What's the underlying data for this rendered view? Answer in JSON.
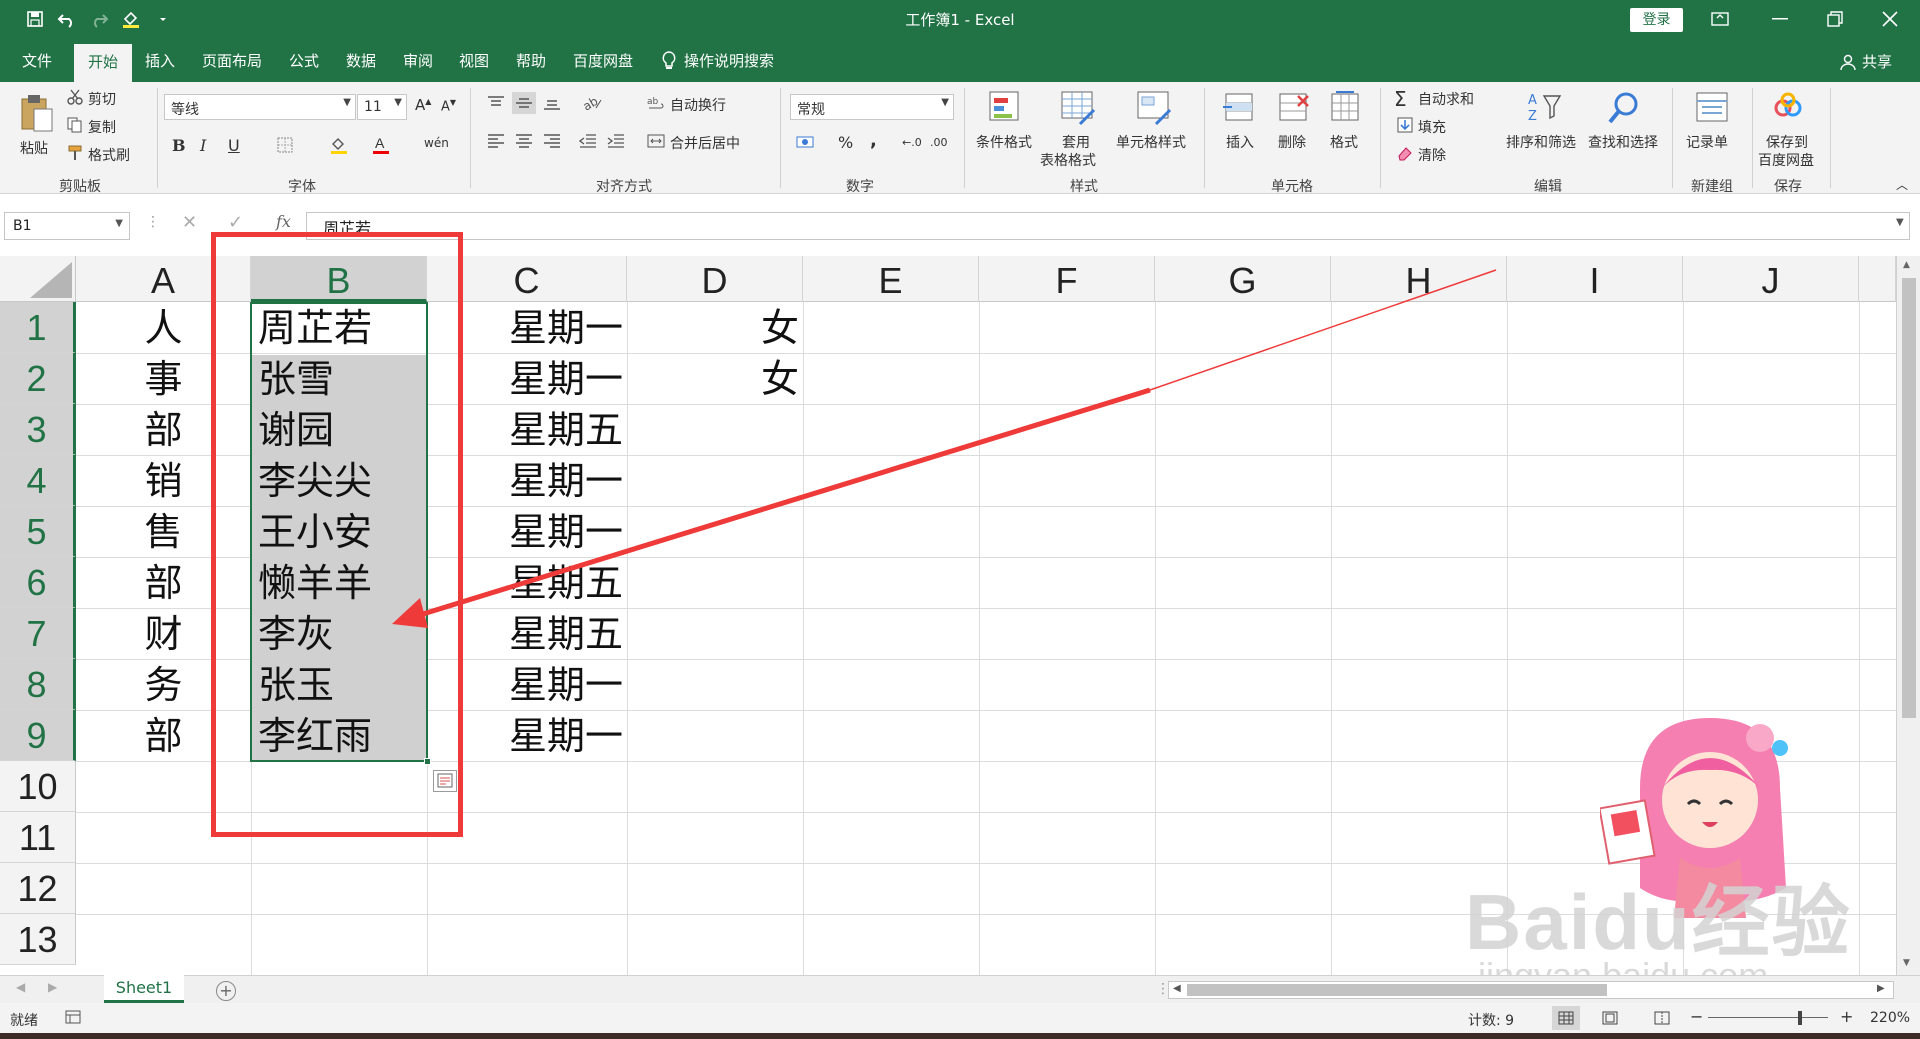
{
  "window": {
    "title": "工作簿1 - Excel",
    "login_label": "登录"
  },
  "tabs": [
    "文件",
    "开始",
    "插入",
    "页面布局",
    "公式",
    "数据",
    "审阅",
    "视图",
    "帮助",
    "百度网盘"
  ],
  "tellme": "操作说明搜索",
  "share": "共享",
  "ribbon": {
    "clipboard": {
      "paste": "粘贴",
      "cut": "剪切",
      "copy": "复制",
      "format_painter": "格式刷",
      "label": "剪贴板"
    },
    "font": {
      "name": "等线",
      "size": "11",
      "bold": "B",
      "italic": "I",
      "underline": "U",
      "label": "字体"
    },
    "alignment": {
      "wrap": "自动换行",
      "merge": "合并后居中",
      "label": "对齐方式"
    },
    "number": {
      "format": "常规",
      "percent": "%",
      "comma": ",",
      "label": "数字"
    },
    "styles": {
      "conditional": "条件格式",
      "table_line1": "套用",
      "table_line2": "表格格式",
      "cell_styles": "单元格样式",
      "label": "样式"
    },
    "cells": {
      "insert": "插入",
      "delete": "删除",
      "format": "格式",
      "label": "单元格"
    },
    "editing": {
      "autosum": "自动求和",
      "fill": "填充",
      "clear": "清除",
      "sort": "排序和筛选",
      "find": "查找和选择",
      "label": "编辑"
    },
    "newgroup": {
      "record": "记录单",
      "label": "新建组"
    },
    "save": {
      "line1": "保存到",
      "line2": "百度网盘",
      "label": "保存"
    }
  },
  "formula_bar": {
    "name_box": "B1",
    "fx": "fx",
    "content": "周芷若"
  },
  "columns": [
    "A",
    "B",
    "C",
    "D",
    "E",
    "F",
    "G",
    "H",
    "I",
    "J"
  ],
  "rows": [
    "1",
    "2",
    "3",
    "4",
    "5",
    "6",
    "7",
    "8",
    "9",
    "10",
    "11",
    "12",
    "13"
  ],
  "cells": {
    "A": [
      "人",
      "事",
      "部",
      "销",
      "售",
      "部",
      "财",
      "务",
      "部"
    ],
    "B": [
      "周芷若",
      "张雪",
      "谢园",
      "李尖尖",
      "王小安",
      "懒羊羊",
      "李灰",
      "张玉",
      "李红雨"
    ],
    "C": [
      "星期一",
      "星期一",
      "星期五",
      "星期一",
      "星期一",
      "星期五",
      "星期五",
      "星期一",
      "星期一"
    ],
    "D": [
      "女",
      "女"
    ]
  },
  "sheet_tab": "Sheet1",
  "status": {
    "ready": "就绪",
    "count": "计数: 9",
    "zoom": "220%"
  },
  "watermark": {
    "brand": "Baidu经验",
    "url": "jingyan.baidu.com"
  },
  "colors": {
    "excel_green": "#217346",
    "annotation_red": "#ef3a3a",
    "selection_gray": "#d0d0d0"
  }
}
